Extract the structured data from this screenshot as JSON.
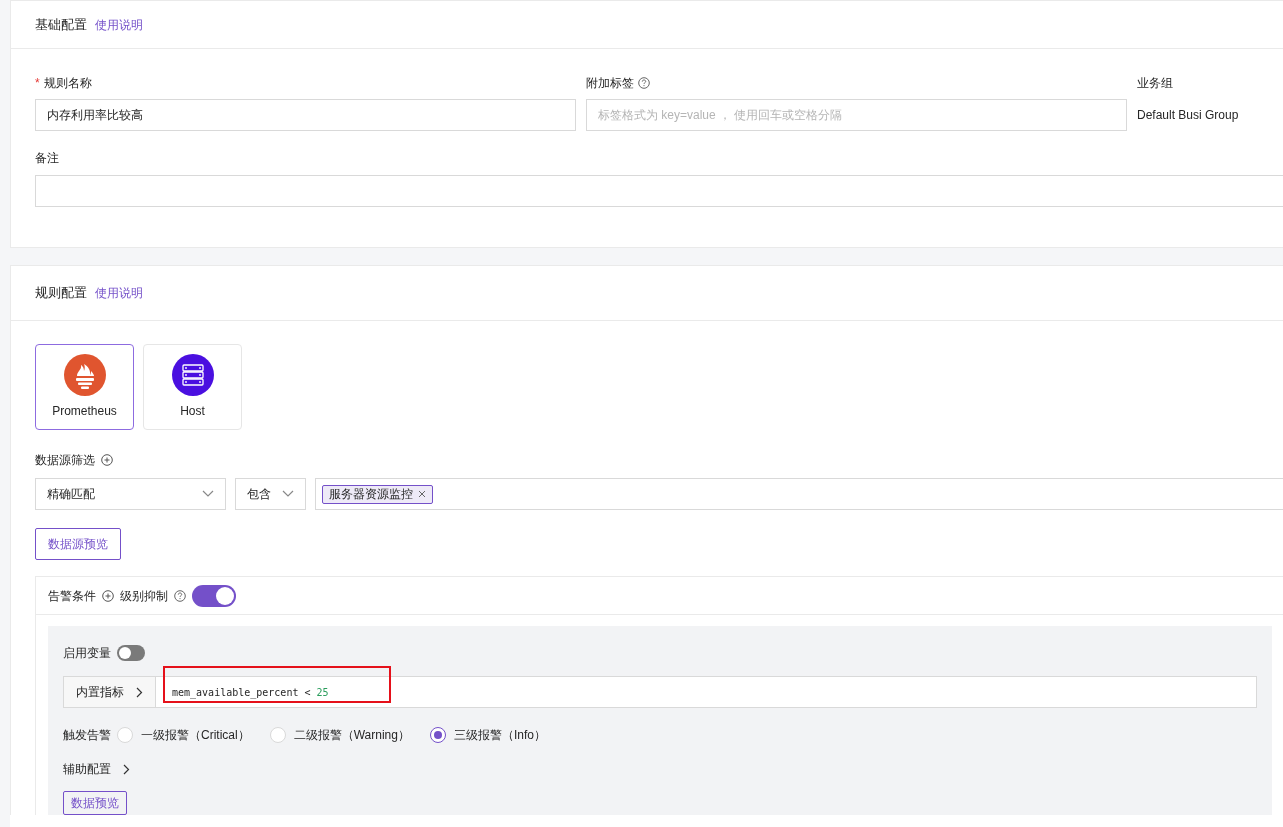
{
  "basic": {
    "title": "基础配置",
    "help_link": "使用说明",
    "fields": [
      {
        "label": "规则名称",
        "required_mark": "*",
        "value": "内存利用率比较高"
      },
      {
        "label": "附加标签",
        "help": true,
        "placeholder": "标签格式为 key=value ， 使用回车或空格分隔"
      }
    ],
    "group": {
      "label": "业务组",
      "value": "Default Busi Group"
    },
    "note": {
      "label": "备注"
    }
  },
  "rule": {
    "title": "规则配置",
    "help_link": "使用说明",
    "datasources": [
      {
        "name": "Prometheus",
        "kind": "prometheus",
        "selected": true
      },
      {
        "name": "Host",
        "kind": "host",
        "selected": false
      }
    ],
    "filter_label": "数据源筛选",
    "filter": {
      "match": "精确匹配",
      "op": "包含",
      "tags": [
        "服务器资源监控"
      ]
    },
    "preview_button": "数据源预览",
    "alert": {
      "title": "告警条件",
      "suppress_label": "级别抑制",
      "suppress_on": true,
      "var_label": "启用变量",
      "var_on": false,
      "metric_addon": "内置指标",
      "query": "mem_available_percent",
      "operator": "<",
      "threshold": "25",
      "trigger_label": "触发告警",
      "levels": [
        {
          "label": "一级报警（Critical）",
          "selected": false
        },
        {
          "label": "二级报警（Warning）",
          "selected": false
        },
        {
          "label": "三级报警（Info）",
          "selected": true
        }
      ],
      "aux_label": "辅助配置",
      "data_preview": "数据预览"
    }
  }
}
